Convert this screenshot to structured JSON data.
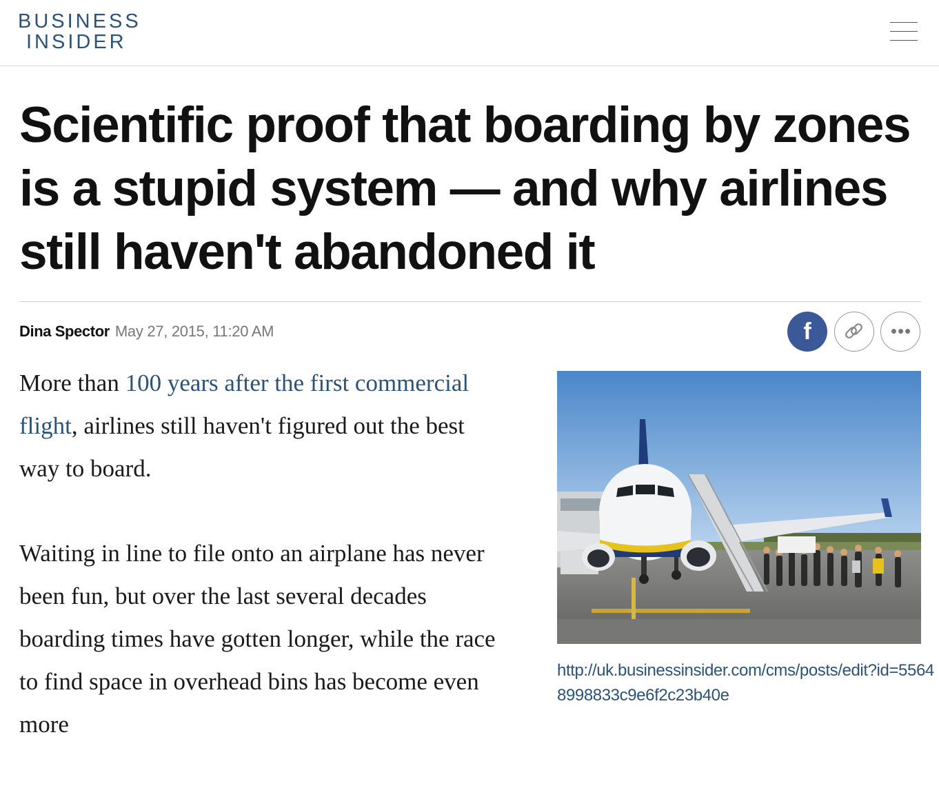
{
  "header": {
    "logo_line1": "BUSINESS",
    "logo_line2": "INSIDER",
    "menu_icon": "hamburger-menu-icon"
  },
  "article": {
    "headline": "Scientific proof that boarding by zones is a stupid system — and why airlines still haven't abandoned it",
    "author": "Dina Spector",
    "date": "May 27, 2015, 11:20 AM",
    "share": {
      "facebook_glyph": "f",
      "link_icon": "link-icon",
      "more_glyph": "•••"
    },
    "paragraphs": [
      {
        "before": "More than ",
        "link": "100 years after the first commercial flight",
        "after": ", airlines still haven't figured out the best way to board."
      },
      {
        "text": "Waiting in line to file onto an airplane has never been fun, but over the last several decades boarding times have gotten longer, while the race to find space in overhead bins has become even more"
      }
    ],
    "image": {
      "icon": "airplane-boarding-photo"
    },
    "caption": "http://uk.businessinsider.com/cms/posts/edit?id=55648998833c9e6f2c23b40e"
  },
  "colors": {
    "brand": "#2c5377",
    "facebook": "#3b5998",
    "text": "#111111",
    "muted": "#777777"
  }
}
